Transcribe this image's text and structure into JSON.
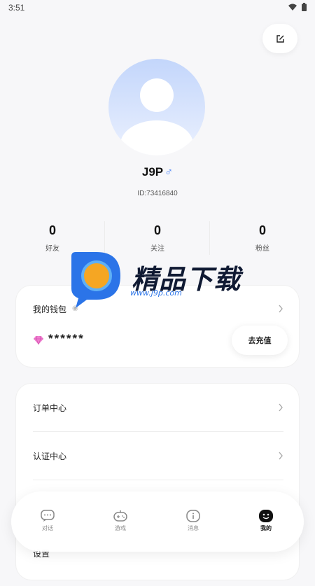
{
  "status_bar": {
    "time": "3:51"
  },
  "profile": {
    "username": "J9P",
    "gender_symbol": "♂",
    "user_id": "ID:73416840"
  },
  "stats": [
    {
      "value": "0",
      "label": "好友"
    },
    {
      "value": "0",
      "label": "关注"
    },
    {
      "value": "0",
      "label": "粉丝"
    }
  ],
  "wallet": {
    "title": "我的钱包",
    "eye_icon": "eye-icon",
    "balance": "******",
    "recharge_label": "去充值"
  },
  "menu": [
    {
      "label": "订单中心"
    },
    {
      "label": "认证中心"
    },
    {
      "label": "设置"
    }
  ],
  "watermark": {
    "text": "精品下载",
    "url": "www.j9p.com"
  },
  "bottom_nav": [
    {
      "label": "对话",
      "icon": "chat-icon"
    },
    {
      "label": "游戏",
      "icon": "gamepad-icon"
    },
    {
      "label": "消息",
      "icon": "info-icon"
    },
    {
      "label": "我的",
      "icon": "smile-icon",
      "active": true
    }
  ],
  "colors": {
    "accent_blue": "#3e7bf6",
    "watermark_orange": "#f5a623",
    "watermark_blue": "#2b74e8"
  }
}
